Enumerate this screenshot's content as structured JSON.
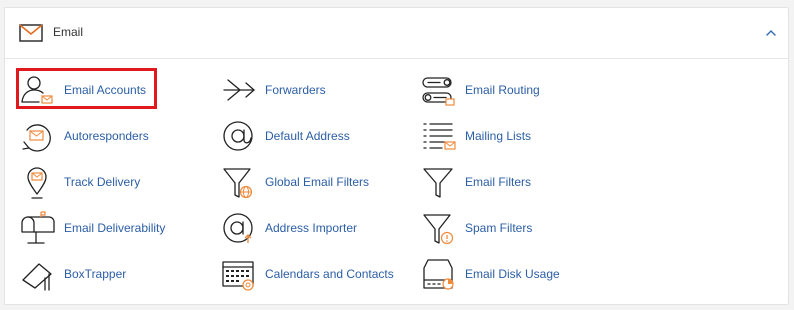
{
  "section": {
    "title": "Email",
    "header_icon": "envelope-icon",
    "collapse_icon": "chevron-up-icon"
  },
  "items": [
    {
      "label": "Email Accounts",
      "icon": "user-envelope-icon",
      "highlighted": true
    },
    {
      "label": "Forwarders",
      "icon": "forward-arrow-icon"
    },
    {
      "label": "Email Routing",
      "icon": "routing-switch-icon"
    },
    {
      "label": "Autoresponders",
      "icon": "autoresponder-icon"
    },
    {
      "label": "Default Address",
      "icon": "at-sign-icon"
    },
    {
      "label": "Mailing Lists",
      "icon": "list-envelope-icon"
    },
    {
      "label": "Track Delivery",
      "icon": "location-pin-icon"
    },
    {
      "label": "Global Email Filters",
      "icon": "funnel-globe-icon"
    },
    {
      "label": "Email Filters",
      "icon": "funnel-icon"
    },
    {
      "label": "Email Deliverability",
      "icon": "mailbox-icon"
    },
    {
      "label": "Address Importer",
      "icon": "at-import-icon"
    },
    {
      "label": "Spam Filters",
      "icon": "funnel-warning-icon"
    },
    {
      "label": "BoxTrapper",
      "icon": "box-trap-icon"
    },
    {
      "label": "Calendars and Contacts",
      "icon": "calendar-at-icon"
    },
    {
      "label": "Email Disk Usage",
      "icon": "disk-usage-icon"
    }
  ],
  "colors": {
    "link": "#2b5ea6",
    "accent": "#f08a3c",
    "highlight": "#e0191f"
  }
}
